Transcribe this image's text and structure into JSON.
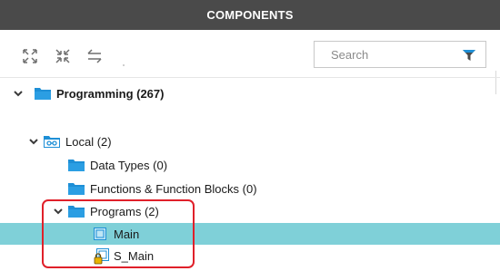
{
  "panel": {
    "title": "COMPONENTS"
  },
  "toolbar": {
    "icons": [
      "expand-all-icon",
      "collapse-all-icon",
      "swap-arrows-icon"
    ],
    "search": {
      "value": "",
      "placeholder": "Search"
    },
    "filter_icon": "filter-icon"
  },
  "colors": {
    "header_bg": "#4a4a4a",
    "folder_blue": "#1e8fd6",
    "selected_row": "#7fd0d8",
    "highlight": "#e0202a"
  },
  "tree": {
    "root": {
      "label": "Programming (267)",
      "expanded": true,
      "icon": "folder-icon"
    },
    "local": {
      "label": "Local (2)",
      "expanded": true,
      "icon": "local-folder-icon"
    },
    "data_types": {
      "label": "Data Types (0)",
      "icon": "folder-icon"
    },
    "functions": {
      "label": "Functions & Function Blocks (0)",
      "icon": "folder-icon"
    },
    "programs": {
      "label": "Programs (2)",
      "expanded": true,
      "icon": "folder-icon"
    },
    "main": {
      "label": "Main",
      "selected": true,
      "icon": "program-icon"
    },
    "s_main": {
      "label": "S_Main",
      "selected": false,
      "icon": "locked-program-icon"
    }
  }
}
